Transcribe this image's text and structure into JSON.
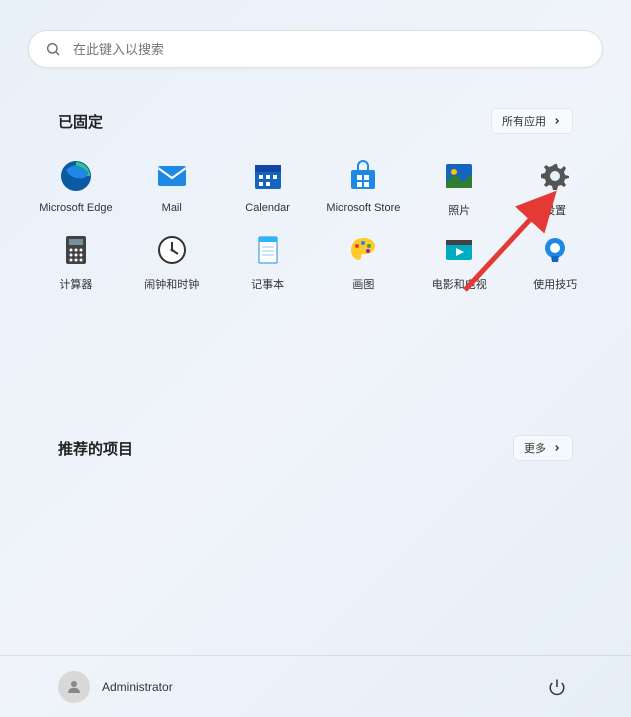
{
  "search": {
    "placeholder": "在此键入以搜索"
  },
  "pinned": {
    "title": "已固定",
    "all_apps_label": "所有应用",
    "apps": [
      {
        "label": "Microsoft Edge",
        "icon": "edge"
      },
      {
        "label": "Mail",
        "icon": "mail"
      },
      {
        "label": "Calendar",
        "icon": "calendar"
      },
      {
        "label": "Microsoft Store",
        "icon": "store"
      },
      {
        "label": "照片",
        "icon": "photos"
      },
      {
        "label": "设置",
        "icon": "settings"
      },
      {
        "label": "计算器",
        "icon": "calculator"
      },
      {
        "label": "闹钟和时钟",
        "icon": "clock"
      },
      {
        "label": "记事本",
        "icon": "notepad"
      },
      {
        "label": "画图",
        "icon": "paint"
      },
      {
        "label": "电影和电视",
        "icon": "movies"
      },
      {
        "label": "使用技巧",
        "icon": "tips"
      }
    ]
  },
  "recommended": {
    "title": "推荐的项目",
    "more_label": "更多"
  },
  "user": {
    "name": "Administrator"
  },
  "highlight_target": "设置"
}
